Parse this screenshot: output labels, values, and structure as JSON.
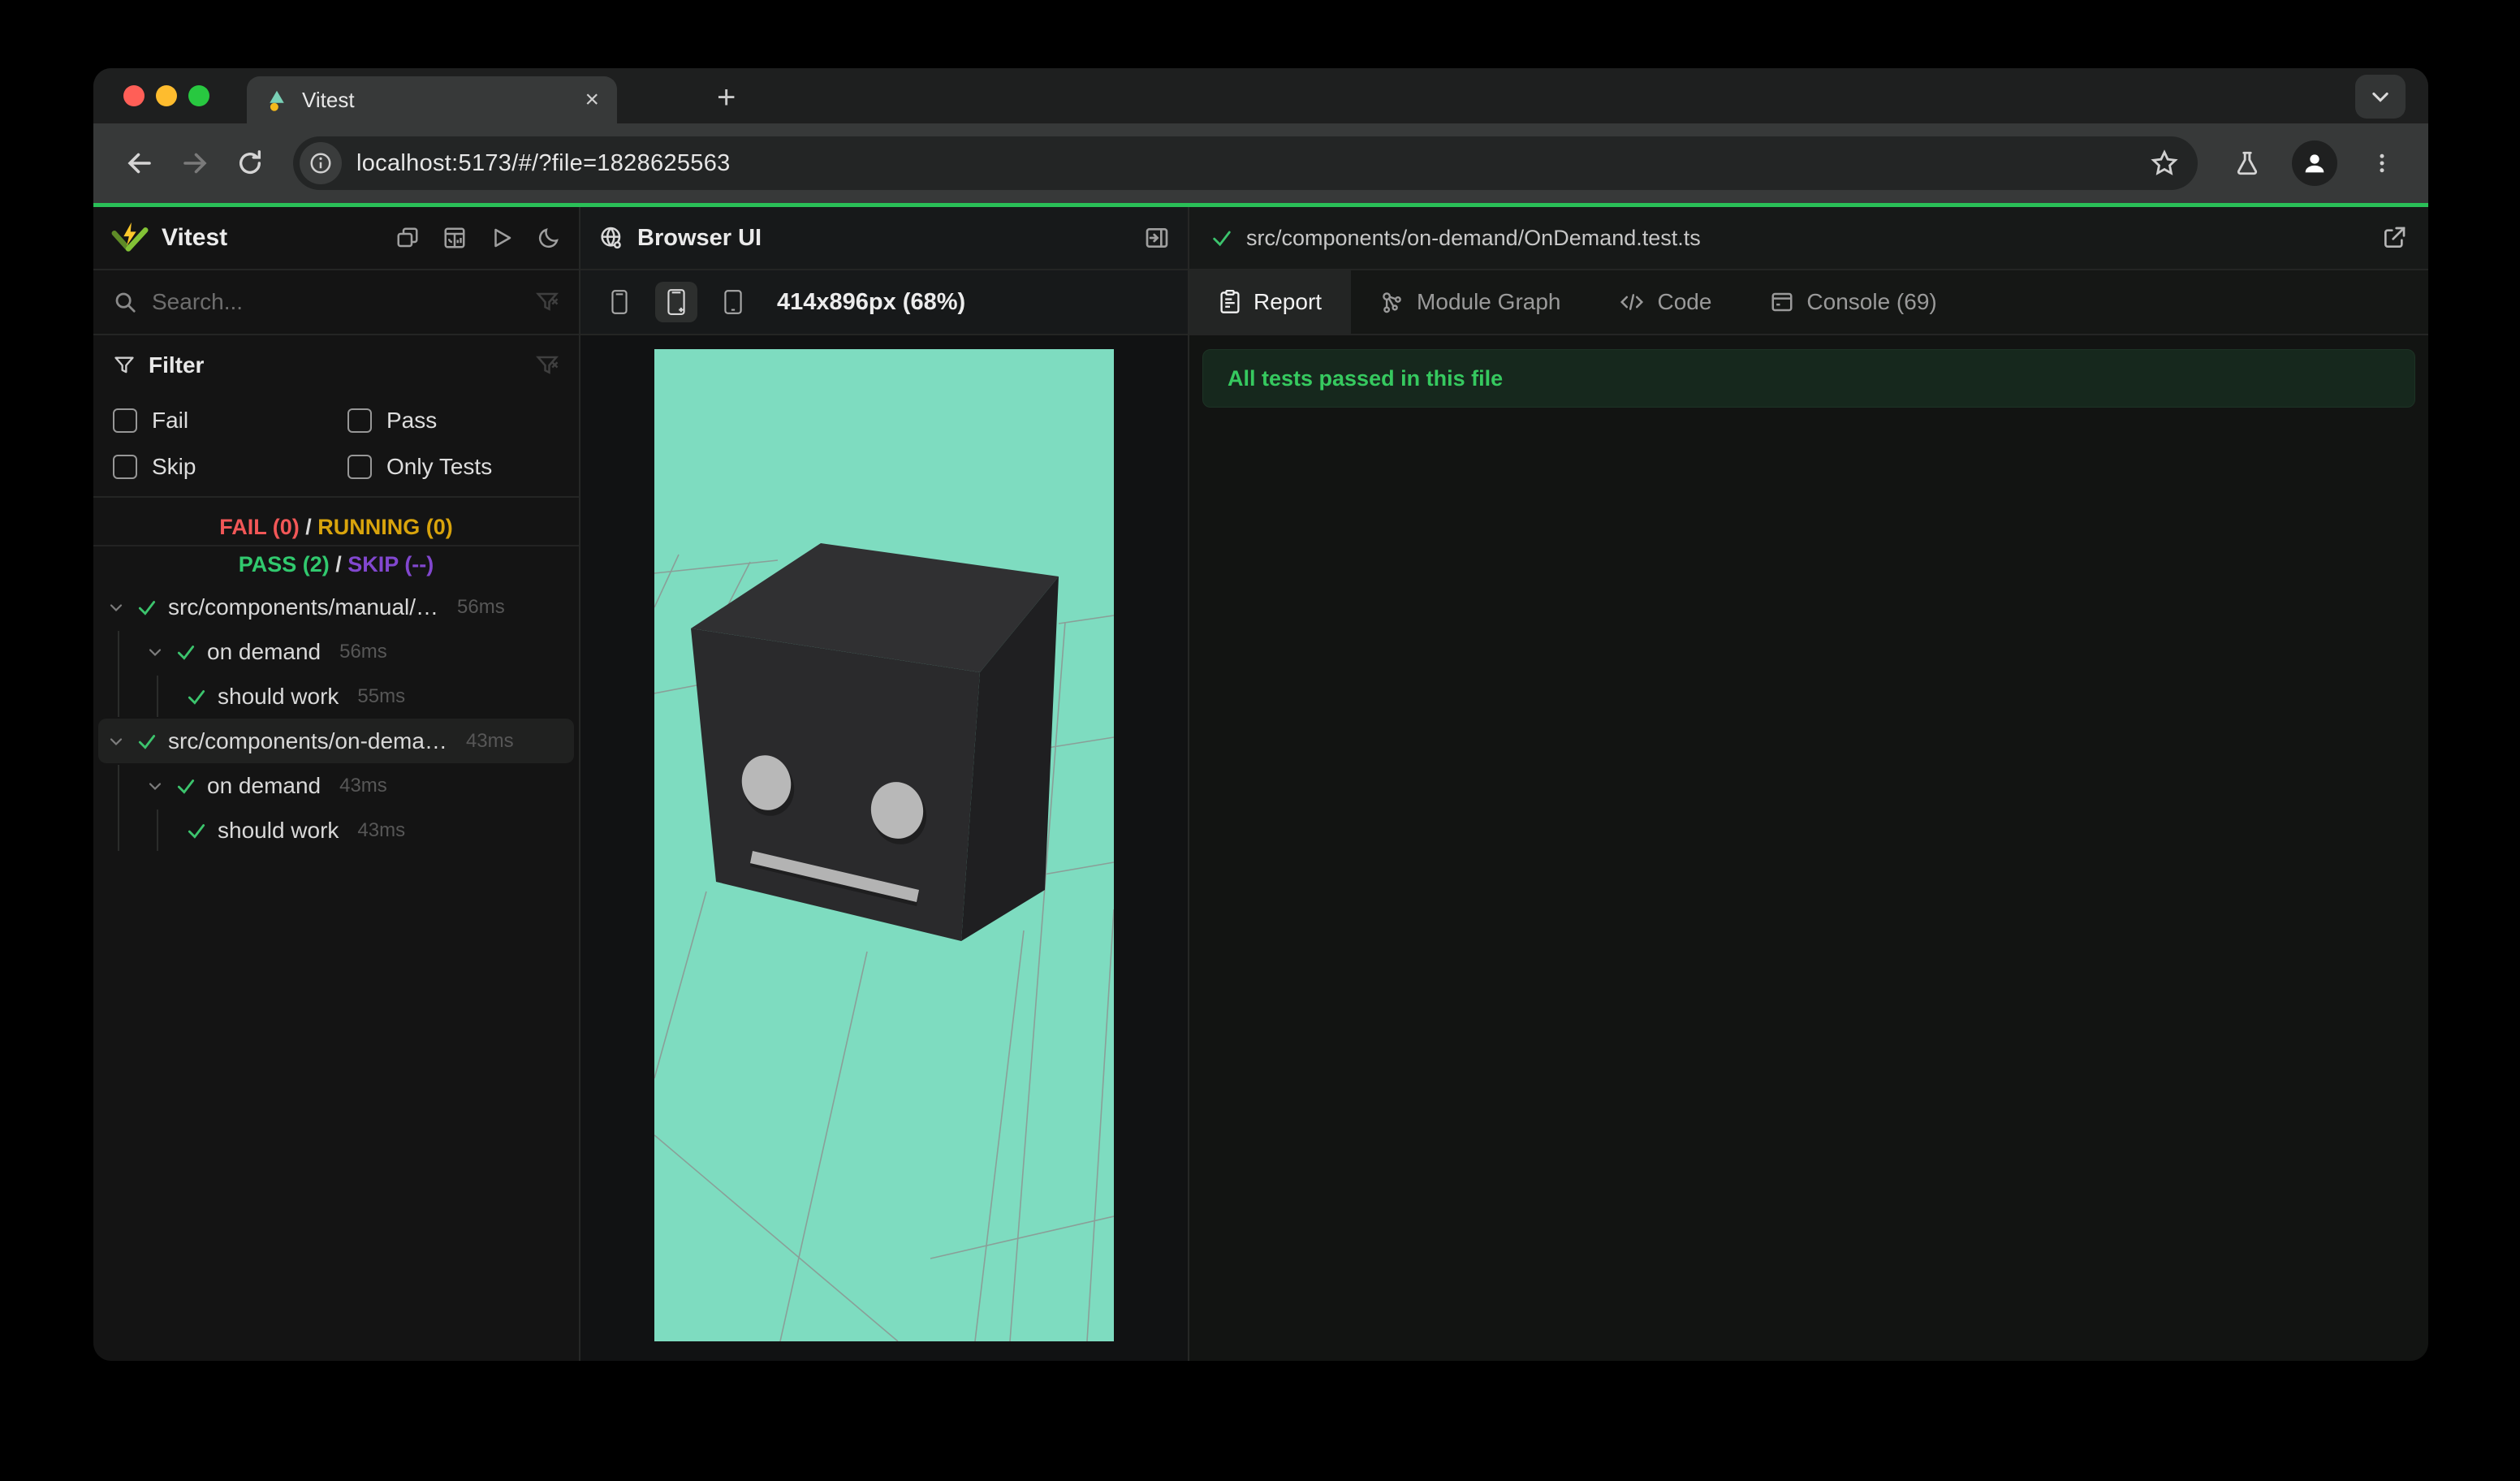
{
  "colors": {
    "progress_green": "#2ac058",
    "pass_green": "#31c96e",
    "fail_red": "#f25757",
    "running_amber": "#d9a40c",
    "skip_purple": "#8247cf",
    "preview_background": "#7edcc0",
    "banner_green": "#36c95f",
    "traffic_red": "#ff5f57",
    "traffic_yellow": "#febc2e",
    "traffic_green": "#28c840"
  },
  "browser": {
    "tab_title": "Vitest",
    "close_glyph": "×",
    "new_tab_glyph": "+",
    "url": "localhost:5173/#/?file=1828625563"
  },
  "sidebar": {
    "app_title": "Vitest",
    "search_placeholder": "Search...",
    "filter": {
      "title": "Filter",
      "options": [
        "Fail",
        "Pass",
        "Skip",
        "Only Tests"
      ]
    },
    "summary": {
      "fail": "FAIL (0)",
      "sep1": "/",
      "running": "RUNNING (0)",
      "pass": "PASS (2)",
      "sep2": "/",
      "skip": "SKIP (--)"
    },
    "tree": [
      {
        "label": "src/components/manual/…",
        "duration": "56ms"
      },
      {
        "label": "on demand",
        "duration": "56ms"
      },
      {
        "label": "should work",
        "duration": "55ms"
      },
      {
        "label": "src/components/on-dema…",
        "duration": "43ms"
      },
      {
        "label": "on demand",
        "duration": "43ms"
      },
      {
        "label": "should work",
        "duration": "43ms"
      }
    ]
  },
  "preview": {
    "panel_title": "Browser UI",
    "viewport_label": "414x896px (68%)"
  },
  "report": {
    "file_path": "src/components/on-demand/OnDemand.test.ts",
    "tabs": [
      "Report",
      "Module Graph",
      "Code",
      "Console (69)"
    ],
    "banner": "All tests passed in this file"
  }
}
